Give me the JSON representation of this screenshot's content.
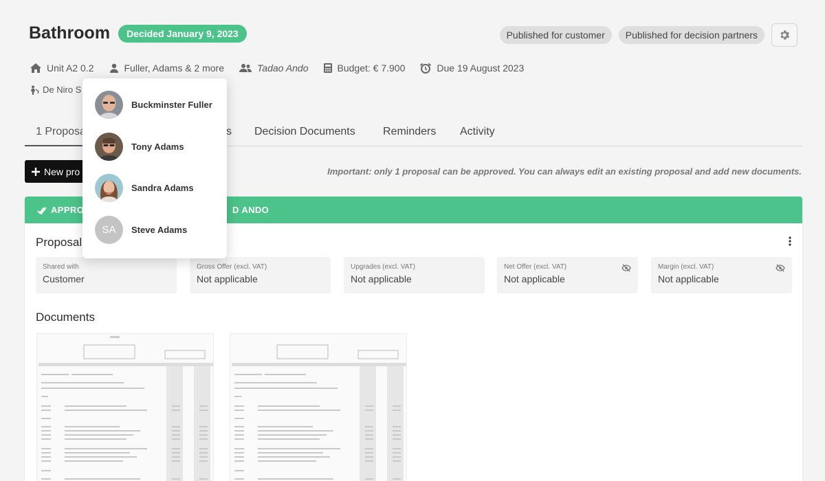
{
  "header": {
    "title": "Bathroom",
    "decided_badge": "Decided January 9, 2023",
    "published_customer": "Published for customer",
    "published_partners": "Published for decision partners"
  },
  "meta": {
    "unit": "Unit A2 0.2",
    "owners": "Fuller, Adams & 2 more",
    "partner": "Tadao Ando",
    "budget": "Budget: € 7.900",
    "due": "Due 19 August 2023",
    "assignee": "De Niro S"
  },
  "tabs": [
    {
      "label": "1 Proposa"
    },
    {
      "label": "s"
    },
    {
      "label": "Decision Documents"
    },
    {
      "label": "Reminders"
    },
    {
      "label": "Activity"
    }
  ],
  "actions": {
    "new_proposal": "New pro",
    "important_note": "Important: only 1 proposal can be approved. You can always edit an existing proposal and add new documents."
  },
  "card": {
    "header_prefix": "APPROV",
    "header_suffix": "D ANDO",
    "proposal_title": "Proposal",
    "info": [
      {
        "label": "Shared with",
        "value": "Customer",
        "hidden": false
      },
      {
        "label": "Gross Offer (excl. VAT)",
        "value": "Not applicable",
        "hidden": false
      },
      {
        "label": "Upgrades (excl. VAT)",
        "value": "Not applicable",
        "hidden": false
      },
      {
        "label": "Net Offer (excl. VAT)",
        "value": "Not applicable",
        "hidden": true
      },
      {
        "label": "Margin (excl. VAT)",
        "value": "Not applicable",
        "hidden": true
      }
    ],
    "documents_title": "Documents"
  },
  "dropdown": {
    "people": [
      {
        "name": "Buckminster Fuller",
        "avatar": "photo"
      },
      {
        "name": "Tony Adams",
        "avatar": "photo"
      },
      {
        "name": "Sandra Adams",
        "avatar": "photo"
      },
      {
        "name": "Steve Adams",
        "avatar": "initials",
        "initials": "SA"
      }
    ]
  },
  "colors": {
    "accent_green": "#4cc38a",
    "dark_button": "#111111"
  },
  "icons": [
    "home-icon",
    "user-icon",
    "users-icon",
    "calculator-icon",
    "alarm-clock-icon",
    "gear-icon",
    "plus-icon",
    "double-check-icon",
    "kebab-menu-icon",
    "eye-off-icon",
    "person-icon"
  ]
}
